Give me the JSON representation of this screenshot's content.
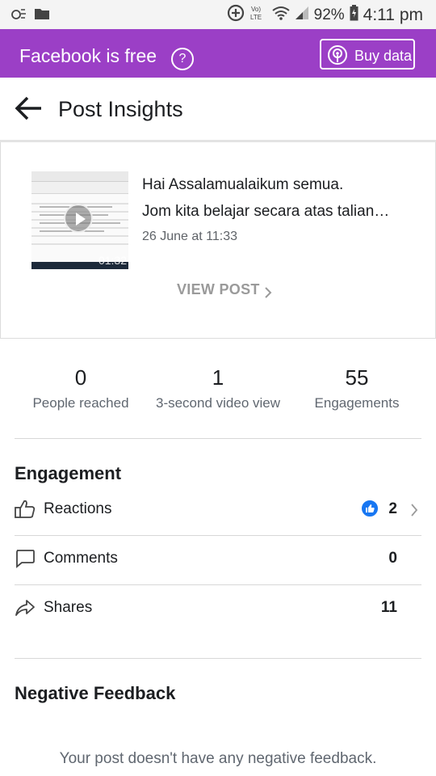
{
  "status_bar": {
    "volte_label": "Vo)\nLTE",
    "battery": "92%",
    "time": "4:11 pm"
  },
  "banner": {
    "text": "Facebook is free",
    "help_icon": "?",
    "buy_label": "Buy data",
    "bg_color": "#9b3fc6"
  },
  "header": {
    "title": "Post Insights",
    "back_icon": "arrow-left"
  },
  "post": {
    "line1": "Hai Assalamualaikum semua.",
    "line2": "Jom kita belajar secara atas talian…",
    "date": "26 June at 11:33",
    "video_duration": "01:32",
    "view_post_label": "VIEW POST"
  },
  "stats": [
    {
      "value": "0",
      "label": "People reached"
    },
    {
      "value": "1",
      "label": "3-second video view"
    },
    {
      "value": "55",
      "label": "Engagements"
    }
  ],
  "engagement": {
    "title": "Engagement",
    "rows": [
      {
        "label": "Reactions",
        "value": "2",
        "icon": "thumbs-up-outline"
      },
      {
        "label": "Comments",
        "value": "0",
        "icon": "comment-bubble"
      },
      {
        "label": "Shares",
        "value": "11",
        "icon": "share-arrow"
      }
    ]
  },
  "negative_feedback": {
    "title": "Negative Feedback",
    "text": "Your post doesn't have any negative feedback."
  }
}
